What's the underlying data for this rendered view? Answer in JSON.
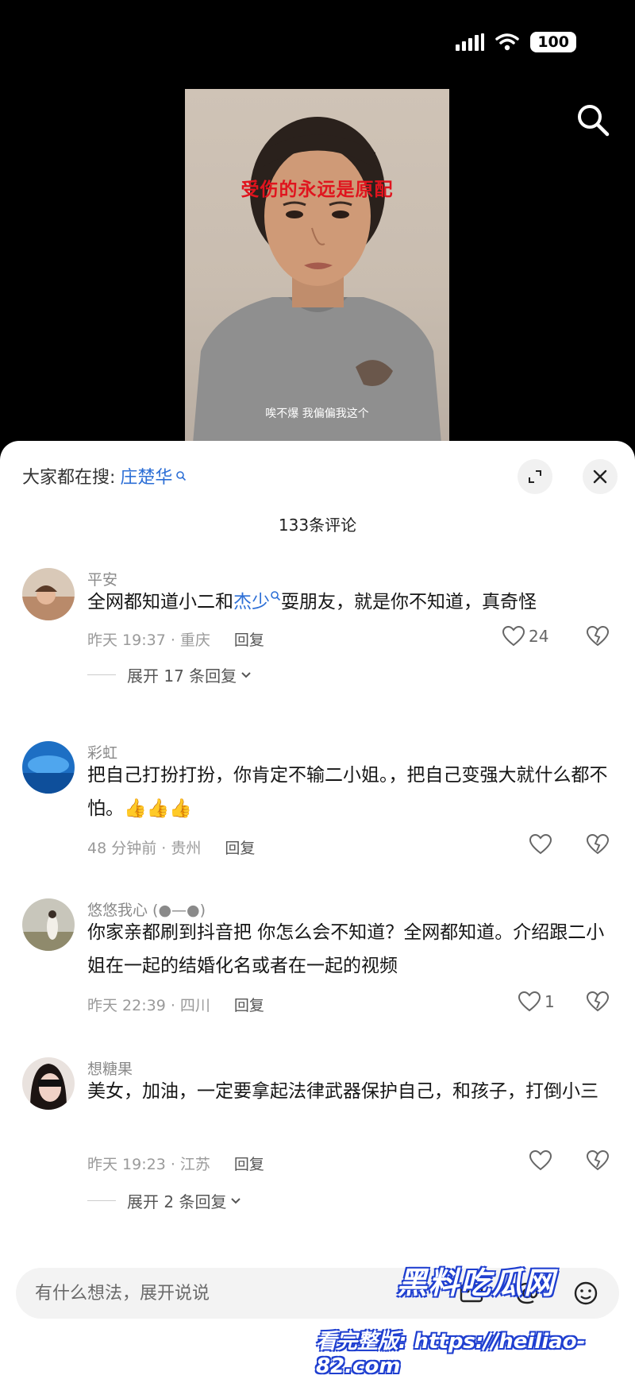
{
  "status": {
    "battery": "100"
  },
  "video": {
    "caption": "受伤的永远是原配",
    "subtitle": "唉不爆 我偏偏我这个"
  },
  "sheet": {
    "search_label": "大家都在搜:",
    "search_term": "庄楚华",
    "comment_count": "133条评论"
  },
  "comments": [
    {
      "name": "平安",
      "text_before": "全网都知道小二和",
      "link": "杰少",
      "text_after": "耍朋友，就是你不知道，真奇怪",
      "meta": "昨天 19:37 · 重庆",
      "reply": "回复",
      "likes": "24",
      "expand": "展开 17 条回复"
    },
    {
      "name": "彩虹",
      "text": "把自己打扮打扮，你肯定不输二小姐。，把自己变强大就什么都不怕。👍👍👍",
      "meta": "48 分钟前 · 贵州",
      "reply": "回复",
      "likes": ""
    },
    {
      "name": "悠悠我心 (●—●)",
      "text": "你家亲都刷到抖音把 你怎么会不知道？全网都知道。介绍跟二小姐在一起的结婚化名或者在一起的视频",
      "meta": "昨天 22:39 · 四川",
      "reply": "回复",
      "likes": "1"
    },
    {
      "name": "想糖果",
      "text": "美女，加油，一定要拿起法律武器保护自己，和孩子，打倒小三",
      "meta": "昨天 19:23 · 江苏",
      "reply": "回复",
      "likes": "",
      "expand": "展开 2 条回复"
    }
  ],
  "input": {
    "placeholder": "有什么想法，展开说说"
  },
  "watermark": {
    "logo": "黑料吃瓜网",
    "url": "看完整版: https://heiliao-82.com"
  },
  "colors": {
    "link": "#2d6fd6",
    "caption": "#e0141e",
    "watermark": "#1f3fd0"
  }
}
